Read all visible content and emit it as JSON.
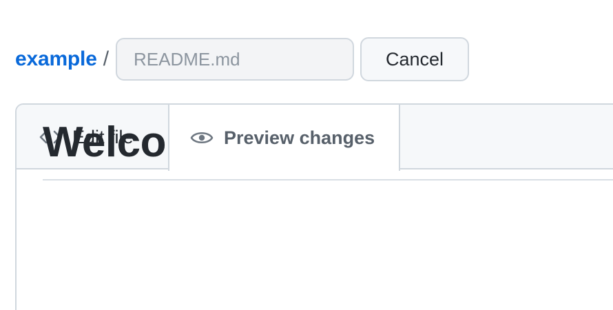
{
  "header": {
    "repo_name": "example",
    "separator": "/",
    "filename_value": "",
    "filename_placeholder": "README.md",
    "cancel_label": "Cancel"
  },
  "tabs": [
    {
      "label": "Edit file",
      "icon": "code-icon",
      "active": false
    },
    {
      "label": "Preview changes",
      "icon": "eye-icon",
      "active": true
    }
  ],
  "preview": {
    "heading": "Welcome!"
  },
  "colors": {
    "link": "#0969da",
    "border": "#d0d7de",
    "text": "#24292f",
    "muted": "#57606a"
  }
}
